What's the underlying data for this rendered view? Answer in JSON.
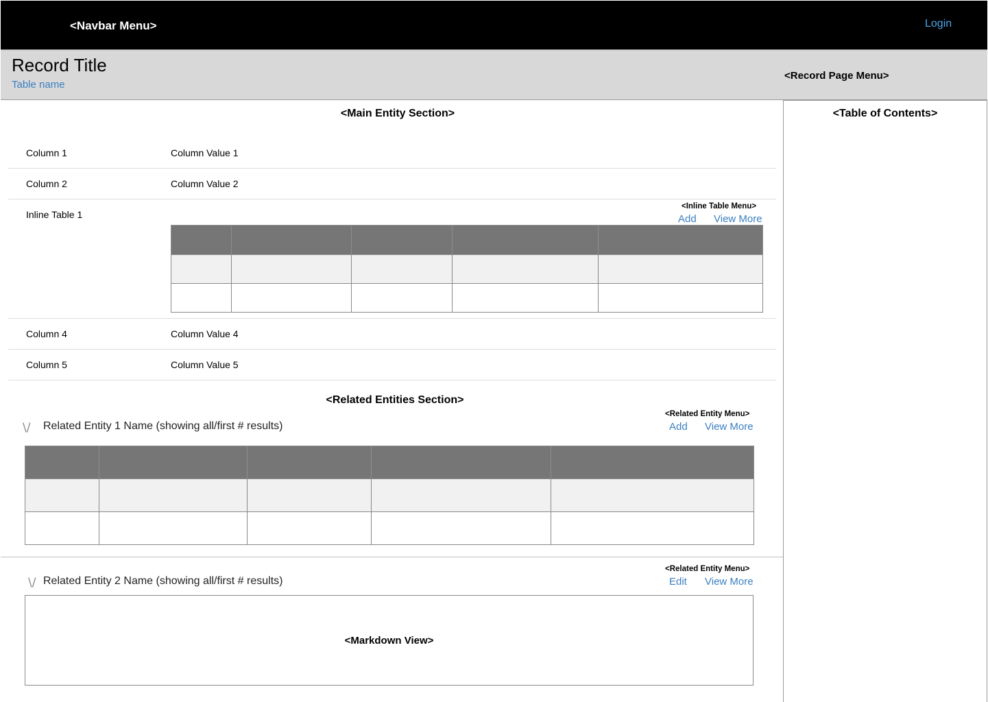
{
  "navbar": {
    "menu_label": "<Navbar Menu>",
    "login_label": "Login"
  },
  "header": {
    "record_title": "Record Title",
    "table_name": "Table name",
    "record_page_menu": "<Record Page Menu>"
  },
  "toc": {
    "title": "<Table of Contents>"
  },
  "main_section": {
    "title": "<Main Entity Section>",
    "rows": [
      {
        "label": "Column 1",
        "value": "Column Value 1"
      },
      {
        "label": "Column 2",
        "value": "Column Value 2"
      },
      {
        "label": "Inline Table 1",
        "value": ""
      },
      {
        "label": "Column 4",
        "value": "Column Value 4"
      },
      {
        "label": "Column 5",
        "value": "Column Value 5"
      }
    ],
    "inline_table": {
      "menu_label": "<Inline Table Menu>",
      "add_label": "Add",
      "view_more_label": "View More"
    }
  },
  "related_section": {
    "title": "<Related Entities Section>",
    "entities": [
      {
        "chevron": "\\/",
        "name": "Related Entity 1 Name (showing all/first # results)",
        "menu_label": "<Related Entity Menu>",
        "action_label": "Add",
        "view_more_label": "View More"
      },
      {
        "chevron": "\\/",
        "name": "Related Entity 2 Name (showing all/first # results)",
        "menu_label": "<Related Entity Menu>",
        "action_label": "Edit",
        "view_more_label": "View More",
        "markdown_label": "<Markdown View>"
      }
    ]
  }
}
